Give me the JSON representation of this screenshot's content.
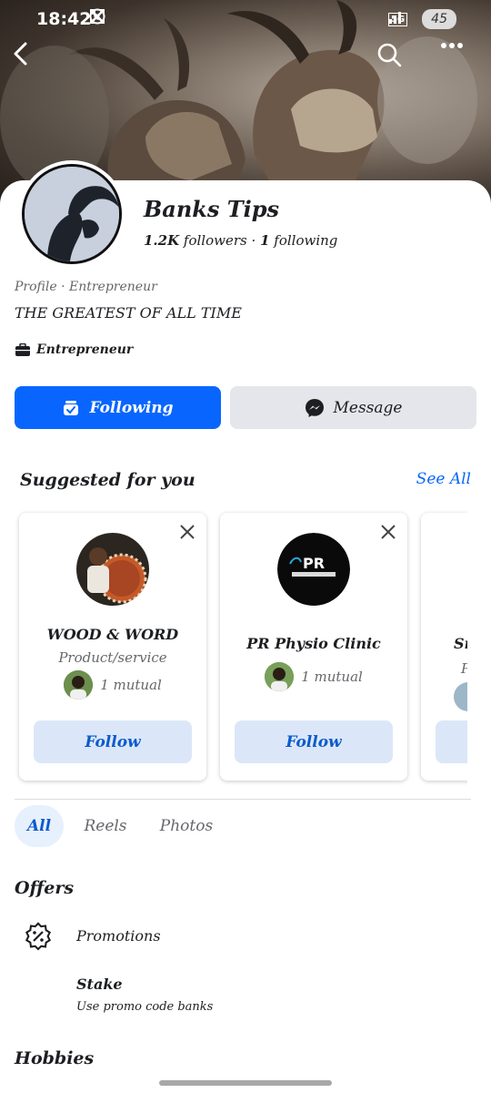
{
  "status_bar": {
    "time": "18:42",
    "network": "5G",
    "battery": "45"
  },
  "profile": {
    "name": "Banks Tips",
    "followers_count": "1.2K",
    "followers_label": "followers",
    "separator": "·",
    "following_count": "1",
    "following_label": "following",
    "category": "Profile · Entrepreneur",
    "bio": "THE GREATEST OF ALL TIME",
    "work": "Entrepreneur"
  },
  "actions": {
    "following_label": "Following",
    "message_label": "Message"
  },
  "suggestions": {
    "title": "Suggested for you",
    "see_all": "See All",
    "cards": [
      {
        "name": "WOOD & WORD",
        "type": "Product/service",
        "mutual": "1 mutual",
        "follow": "Follow"
      },
      {
        "name": "PR Physio Clinic",
        "type": "",
        "mutual": "1 mutual",
        "follow": "Follow"
      },
      {
        "name": "Sn",
        "type": "P",
        "mutual": "",
        "follow": ""
      }
    ]
  },
  "tabs": [
    "All",
    "Reels",
    "Photos"
  ],
  "offers": {
    "title": "Offers",
    "promotions_label": "Promotions",
    "item_title": "Stake",
    "item_sub": "Use promo code banks"
  },
  "hobbies": {
    "title": "Hobbies"
  },
  "colors": {
    "accent": "#0866ff",
    "secondary_button": "#e4e6eb",
    "follow_button": "#dbe7f8"
  },
  "icons": {
    "back": "chevron-left-icon",
    "search": "search-icon",
    "more": "more-dots-icon",
    "following": "following-check-icon",
    "message": "messenger-icon",
    "close": "close-icon",
    "work": "briefcase-icon",
    "promotion": "discount-badge-icon"
  }
}
